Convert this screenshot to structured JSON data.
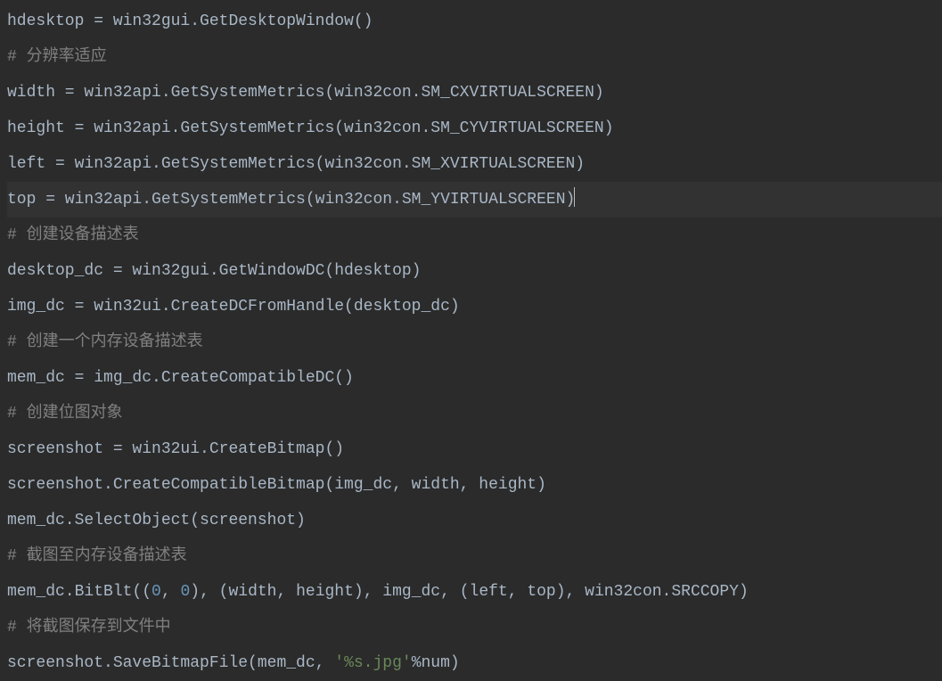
{
  "lines": [
    {
      "parts": [
        {
          "t": "hdesktop = win32gui.GetDesktopWindow()",
          "c": "default"
        }
      ]
    },
    {
      "parts": [
        {
          "t": "# 分辨率适应",
          "c": "comment"
        }
      ]
    },
    {
      "parts": [
        {
          "t": "width = win32api.GetSystemMetrics(win32con.SM_CXVIRTUALSCREEN)",
          "c": "default"
        }
      ]
    },
    {
      "parts": [
        {
          "t": "height = win32api.GetSystemMetrics(win32con.SM_CYVIRTUALSCREEN)",
          "c": "default"
        }
      ]
    },
    {
      "parts": [
        {
          "t": "left = win32api.GetSystemMetrics(win32con.SM_XVIRTUALSCREEN)",
          "c": "default"
        }
      ]
    },
    {
      "highlighted": true,
      "caret": true,
      "parts": [
        {
          "t": "top = win32api.GetSystemMetrics(win32con.SM_YVIRTUALSCREEN)",
          "c": "default"
        }
      ]
    },
    {
      "parts": [
        {
          "t": "# 创建设备描述表",
          "c": "comment"
        }
      ]
    },
    {
      "parts": [
        {
          "t": "desktop_dc = win32gui.GetWindowDC(hdesktop)",
          "c": "default"
        }
      ]
    },
    {
      "parts": [
        {
          "t": "img_dc = win32ui.CreateDCFromHandle(desktop_dc)",
          "c": "default"
        }
      ]
    },
    {
      "parts": [
        {
          "t": "# 创建一个内存设备描述表",
          "c": "comment"
        }
      ]
    },
    {
      "parts": [
        {
          "t": "mem_dc = img_dc.CreateCompatibleDC()",
          "c": "default"
        }
      ]
    },
    {
      "parts": [
        {
          "t": "# 创建位图对象",
          "c": "comment"
        }
      ]
    },
    {
      "parts": [
        {
          "t": "screenshot = win32ui.CreateBitmap()",
          "c": "default"
        }
      ]
    },
    {
      "parts": [
        {
          "t": "screenshot.CreateCompatibleBitmap(img_dc, width, height)",
          "c": "default"
        }
      ]
    },
    {
      "parts": [
        {
          "t": "mem_dc.SelectObject(screenshot)",
          "c": "default"
        }
      ]
    },
    {
      "parts": [
        {
          "t": "# 截图至内存设备描述表",
          "c": "comment"
        }
      ]
    },
    {
      "parts": [
        {
          "t": "mem_dc.BitBlt((",
          "c": "default"
        },
        {
          "t": "0",
          "c": "number"
        },
        {
          "t": ", ",
          "c": "default"
        },
        {
          "t": "0",
          "c": "number"
        },
        {
          "t": "), (width, height), img_dc, (left, top), win32con.SRCCOPY)",
          "c": "default"
        }
      ]
    },
    {
      "parts": [
        {
          "t": "# 将截图保存到文件中",
          "c": "comment"
        }
      ]
    },
    {
      "parts": [
        {
          "t": "screenshot.SaveBitmapFile(mem_dc, ",
          "c": "default"
        },
        {
          "t": "'%s.jpg'",
          "c": "string"
        },
        {
          "t": "%num)",
          "c": "default"
        }
      ]
    }
  ]
}
